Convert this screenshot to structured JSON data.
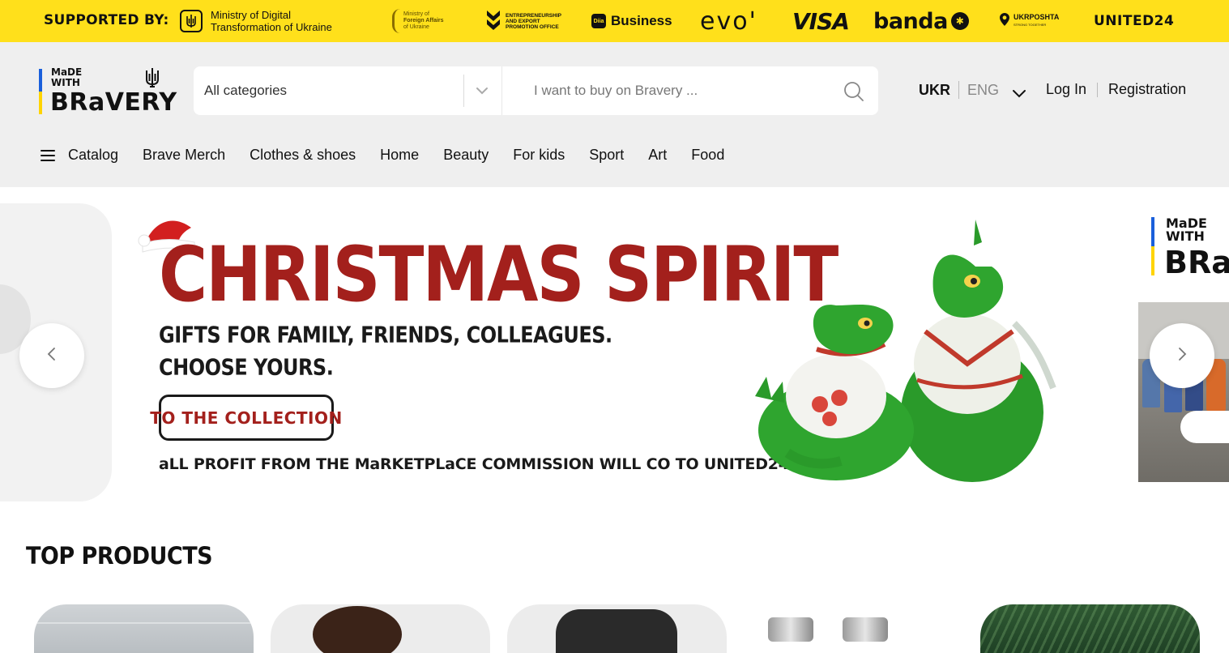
{
  "sponsors": {
    "label": "SUPPORTED BY:",
    "mindigit_line1": "Ministry of Digital",
    "mindigit_line2": "Transformation of Ukraine",
    "mfa_line1": "Ministry of",
    "mfa_line2": "Foreign Affairs",
    "mfa_line3": "of Ukraine",
    "epo_line1": "ENTREPRENEURSHIP",
    "epo_line2": "AND EXPORT",
    "epo_line3": "PROMOTION OFFICE",
    "diia_mark": "Diia",
    "diia_text": "Business",
    "evo": "evo'",
    "visa": "VISA",
    "banda": "banda",
    "ukrposhta": "UKRPOSHTA",
    "ukrposhta_sub": "STRONG TOGETHER",
    "united24": "UNITED24"
  },
  "logo": {
    "line1": "MaDE",
    "line2": "WITH",
    "line3": "BRaVERY"
  },
  "search": {
    "category_selected": "All categories",
    "placeholder": "I want to buy on Bravery ..."
  },
  "language": {
    "active": "UKR",
    "other": "ENG"
  },
  "auth": {
    "login": "Log In",
    "register": "Registration"
  },
  "nav": {
    "catalog": "Catalog",
    "items": [
      "Brave Merch",
      "Clothes & shoes",
      "Home",
      "Beauty",
      "For kids",
      "Sport",
      "Art",
      "Food"
    ]
  },
  "banner": {
    "title": "CHRISTMAS SPIRIT",
    "subtitle1": "GIFTS FOR FAMILY, FRIENDS, COLLEAGUES.",
    "subtitle2": "CHOOSE YOURS.",
    "cta": "TO THE COLLECTION",
    "footer": "aLL PROFIT FROM THE MaRKETPLaCE COMMISSION WILL CO TO UNITED24",
    "next_logo_line1": "MaDE",
    "next_logo_line2": "WITH",
    "next_logo_line3": "BRav"
  },
  "sections": {
    "top_products": "TOP PRODUCTS"
  },
  "colors": {
    "sponsor_bar": "#ffe01b",
    "header_bg": "#efefef",
    "banner_title": "#a3201c",
    "logo_blue": "#1a5fdb",
    "logo_yellow": "#ffd400"
  },
  "icons": {
    "search": "search-icon",
    "chevron": "chevron-down-icon",
    "menu": "hamburger-menu-icon",
    "arrow_left": "arrow-left-icon",
    "arrow_right": "arrow-right-icon"
  }
}
